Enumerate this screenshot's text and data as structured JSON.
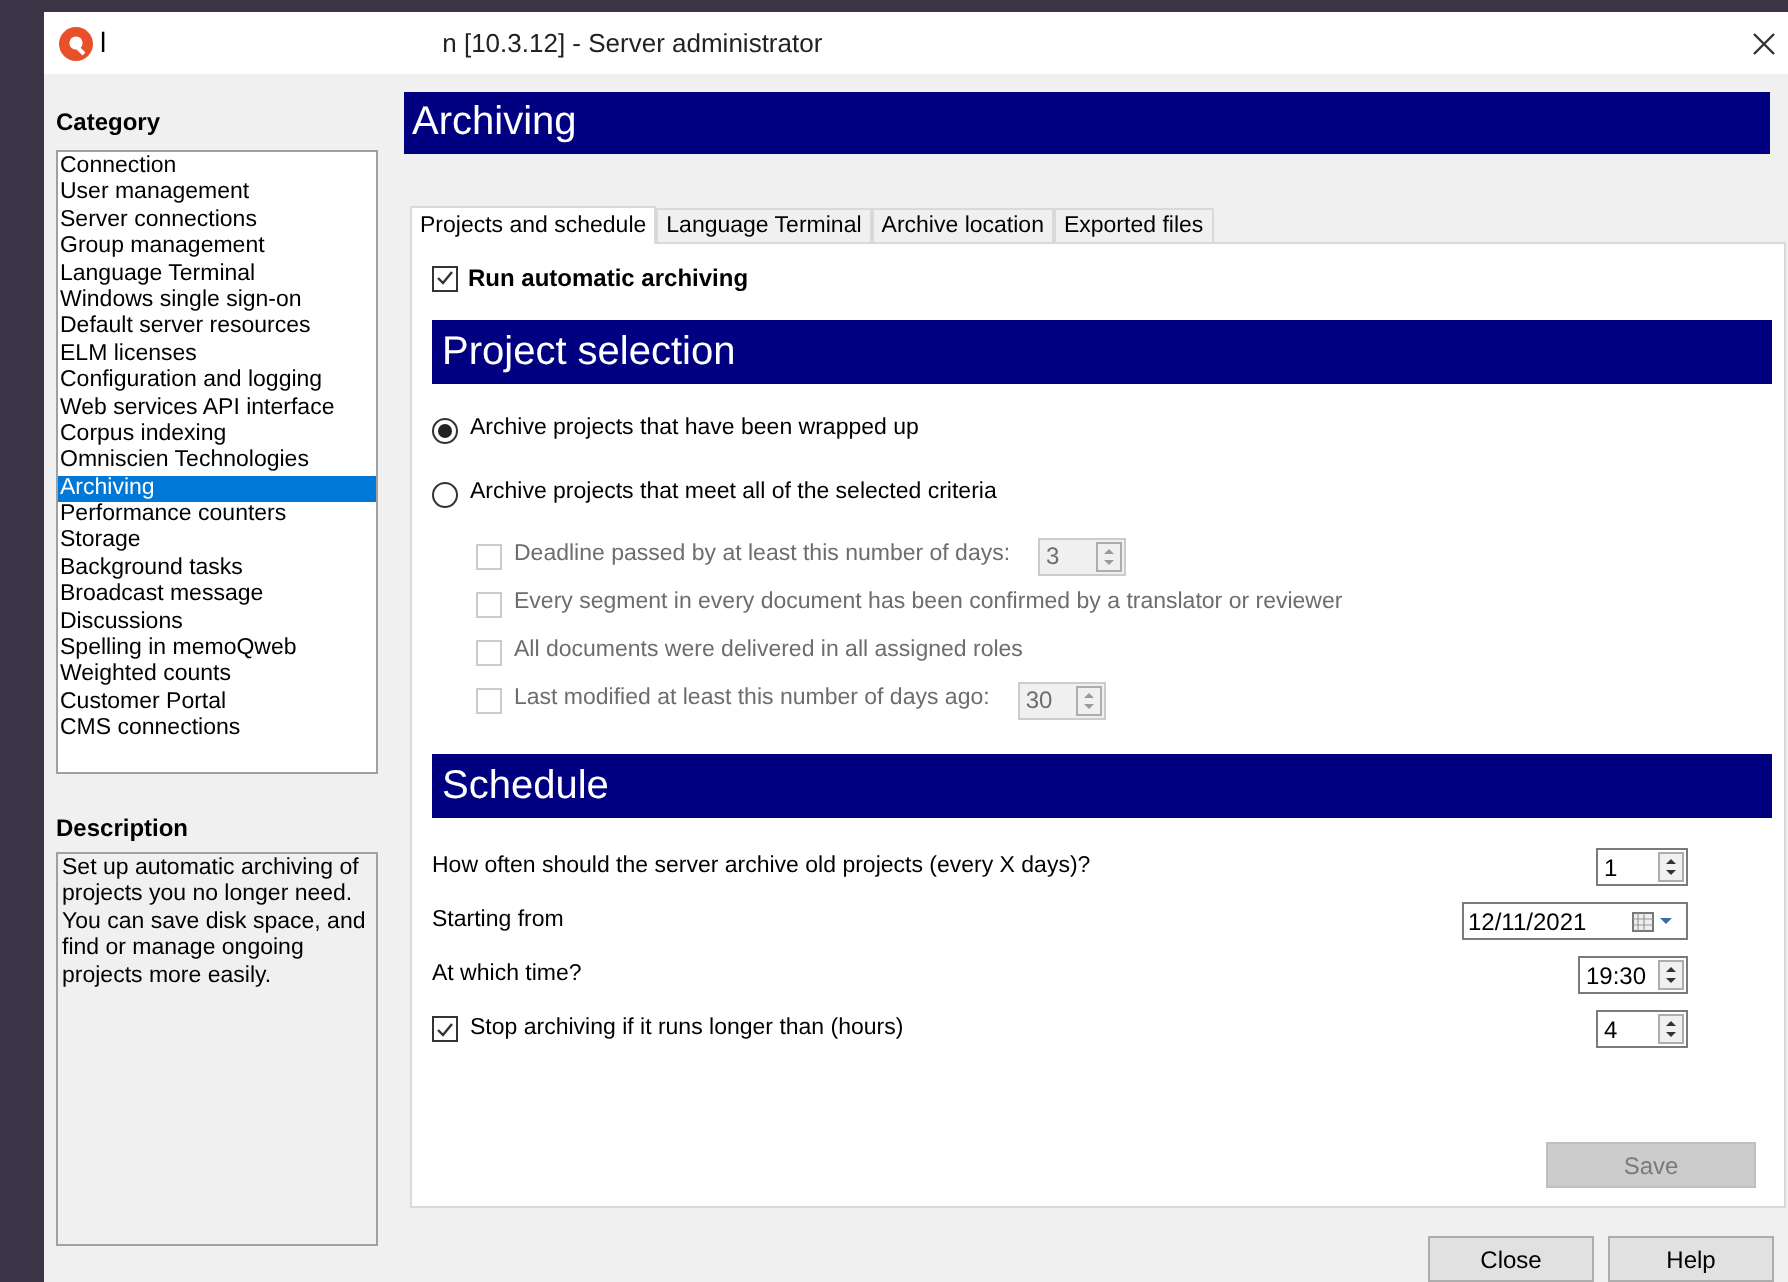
{
  "window": {
    "app_letter": "l",
    "title": "n [10.3.12] - Server administrator"
  },
  "category": {
    "label": "Category",
    "items": [
      {
        "label": "Connection",
        "selected": false
      },
      {
        "label": "User management",
        "selected": false
      },
      {
        "label": "Server connections",
        "selected": false
      },
      {
        "label": "Group management",
        "selected": false
      },
      {
        "label": "Language Terminal",
        "selected": false
      },
      {
        "label": "Windows single sign-on",
        "selected": false
      },
      {
        "label": "Default server resources",
        "selected": false
      },
      {
        "label": "ELM licenses",
        "selected": false
      },
      {
        "label": "Configuration and logging",
        "selected": false
      },
      {
        "label": "Web services API interface",
        "selected": false
      },
      {
        "label": "Corpus indexing",
        "selected": false
      },
      {
        "label": "Omniscien Technologies",
        "selected": false
      },
      {
        "label": "Archiving",
        "selected": true
      },
      {
        "label": "Performance counters",
        "selected": false
      },
      {
        "label": "Storage",
        "selected": false
      },
      {
        "label": "Background tasks",
        "selected": false
      },
      {
        "label": "Broadcast message",
        "selected": false
      },
      {
        "label": "Discussions",
        "selected": false
      },
      {
        "label": "Spelling in memoQweb",
        "selected": false
      },
      {
        "label": "Weighted counts",
        "selected": false
      },
      {
        "label": "Customer Portal",
        "selected": false
      },
      {
        "label": "CMS connections",
        "selected": false
      }
    ]
  },
  "description": {
    "label": "Description",
    "text": "Set up automatic archiving of projects you no longer need. You can save disk space, and find or manage ongoing projects more easily."
  },
  "header": "Archiving",
  "tabs": [
    {
      "label": "Projects and schedule",
      "selected": true
    },
    {
      "label": "Language Terminal",
      "selected": false
    },
    {
      "label": "Archive location",
      "selected": false
    },
    {
      "label": "Exported files",
      "selected": false
    }
  ],
  "run_automatic": {
    "label": "Run automatic archiving",
    "checked": true
  },
  "project_selection": {
    "title": "Project selection",
    "options": [
      {
        "label": "Archive projects that have been wrapped up",
        "selected": true
      },
      {
        "label": "Archive projects that meet all of the selected criteria",
        "selected": false
      }
    ],
    "criteria": [
      {
        "label": "Deadline passed by at least this number of days:",
        "checked": false,
        "disabled": true,
        "value": "3"
      },
      {
        "label": "Every segment in every document has been confirmed by a translator or reviewer",
        "checked": false,
        "disabled": true
      },
      {
        "label": "All documents were delivered in all assigned roles",
        "checked": false,
        "disabled": true
      },
      {
        "label": "Last modified at least this number of days ago:",
        "checked": false,
        "disabled": true,
        "value": "30"
      }
    ]
  },
  "schedule": {
    "title": "Schedule",
    "rows": [
      {
        "kind": "spin",
        "label": "How often should the server archive old projects (every X days)?",
        "value": "1"
      },
      {
        "kind": "date",
        "label": "Starting from",
        "value": "12/11/2021"
      },
      {
        "kind": "time",
        "label": "At which time?",
        "value": "19:30"
      },
      {
        "kind": "check_spin",
        "label": "Stop archiving if it runs longer than (hours)",
        "checked": true,
        "value": "4"
      }
    ]
  },
  "save_button": {
    "label": "Save",
    "disabled": true
  },
  "buttons": [
    "Close",
    "Help"
  ]
}
